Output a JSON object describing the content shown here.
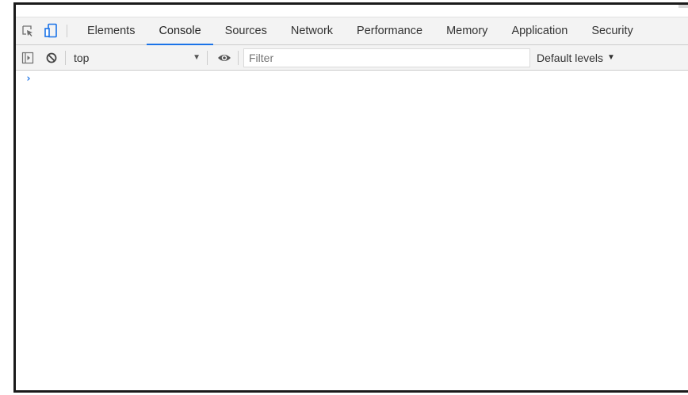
{
  "devtools": {
    "tabs": [
      {
        "label": "Elements"
      },
      {
        "label": "Console"
      },
      {
        "label": "Sources"
      },
      {
        "label": "Network"
      },
      {
        "label": "Performance"
      },
      {
        "label": "Memory"
      },
      {
        "label": "Application"
      },
      {
        "label": "Security"
      }
    ],
    "active_tab": "Console",
    "icons": {
      "inspect": "inspect-element-icon",
      "device": "device-toolbar-icon",
      "sidebar": "show-sidebar-icon",
      "clear": "clear-console-icon",
      "eye": "live-expression-icon"
    },
    "accent_color": "#1a73e8"
  },
  "console_toolbar": {
    "context_value": "top",
    "context_arrow": "▼",
    "filter_placeholder": "Filter",
    "filter_value": "",
    "levels_label": "Default levels",
    "levels_caret": "▼"
  },
  "console": {
    "prompt_symbol": "›",
    "input_value": ""
  }
}
